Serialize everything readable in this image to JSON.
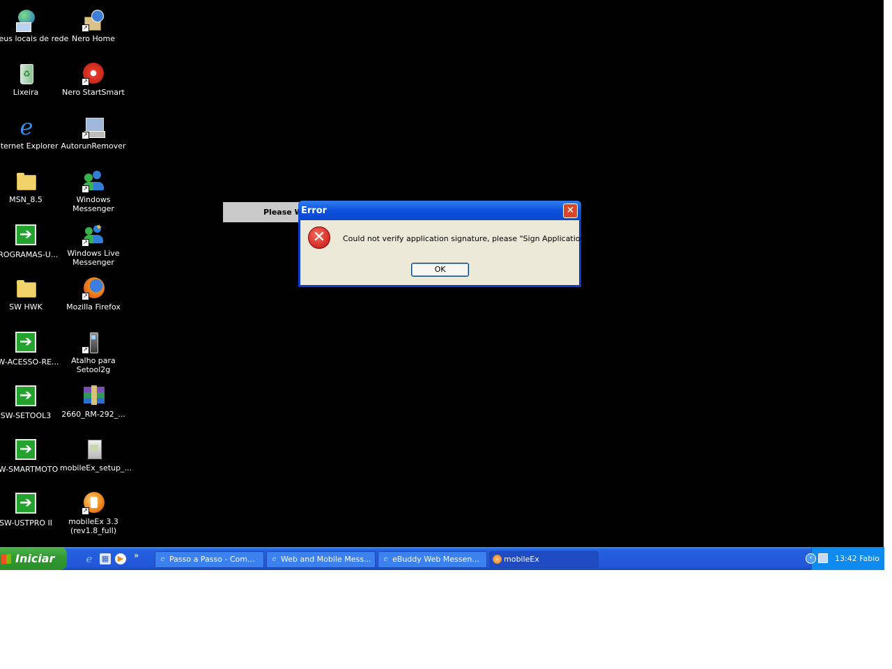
{
  "desktop_icons": [
    {
      "label": "Meus locais de rede",
      "icon": "network-places-icon"
    },
    {
      "label": "Nero Home",
      "icon": "nero-home-icon"
    },
    {
      "label": "Lixeira",
      "icon": "recycle-bin-icon"
    },
    {
      "label": "Nero StartSmart",
      "icon": "nero-startsmart-icon"
    },
    {
      "label": "Internet Explorer",
      "icon": "internet-explorer-icon"
    },
    {
      "label": "AutorunRemover",
      "icon": "autorun-remover-icon"
    },
    {
      "label": "MSN_8.5",
      "icon": "folder-icon"
    },
    {
      "label": "Windows Messenger",
      "icon": "windows-messenger-icon"
    },
    {
      "label": "PROGRAMAS-U...",
      "icon": "arrow-shortcut-icon"
    },
    {
      "label": "Windows Live Messenger",
      "icon": "windows-live-messenger-icon"
    },
    {
      "label": "SW HWK",
      "icon": "folder-icon"
    },
    {
      "label": "Mozilla Firefox",
      "icon": "firefox-icon"
    },
    {
      "label": "SW-ACESSO-RE...",
      "icon": "arrow-shortcut-icon"
    },
    {
      "label": "Atalho para Setool2g",
      "icon": "phone-icon"
    },
    {
      "label": "SW-SETOOL3",
      "icon": "arrow-shortcut-icon"
    },
    {
      "label": "2660_RM-292_...",
      "icon": "winrar-archive-icon"
    },
    {
      "label": "SW-SMARTMOTO",
      "icon": "arrow-shortcut-icon"
    },
    {
      "label": "mobileEx_setup_...",
      "icon": "setup-installer-icon"
    },
    {
      "label": "SW-USTPRO II",
      "icon": "arrow-shortcut-icon"
    },
    {
      "label": "mobileEx 3.3 (rev1.8_full)",
      "icon": "mobileex-icon"
    }
  ],
  "background_window": {
    "label": "Please W"
  },
  "dialog": {
    "title": "Error",
    "message": "Could not verify application signature, please \"Sign Application\" first !",
    "ok_label": "OK",
    "close_glyph": "✕"
  },
  "taskbar": {
    "start_label": "Iniciar",
    "chevron": "»",
    "buttons": [
      {
        "label": "Passo a Passo - Com...",
        "icon": "internet-explorer-icon"
      },
      {
        "label": "Web and Mobile Mess...",
        "icon": "internet-explorer-icon"
      },
      {
        "label": "eBuddy Web Messen...",
        "icon": "internet-explorer-icon"
      },
      {
        "label": "mobileEx",
        "icon": "mobileex-icon"
      }
    ],
    "clock": "13:42 Fabio"
  }
}
